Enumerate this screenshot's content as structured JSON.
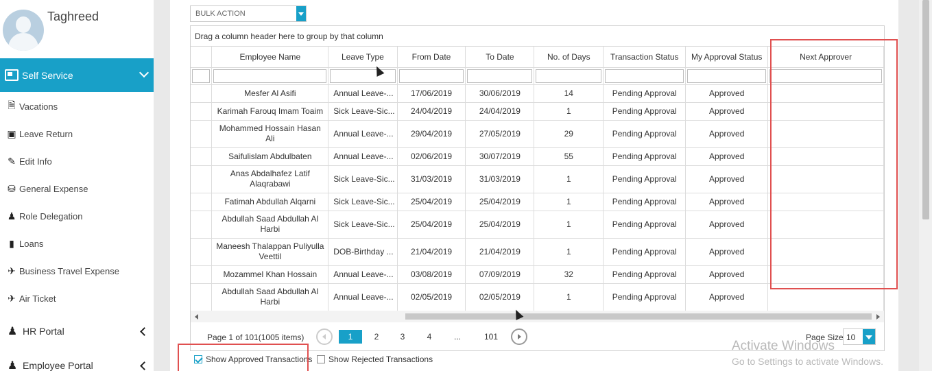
{
  "user": {
    "name": "Taghreed"
  },
  "sidebar": {
    "active": {
      "label": "Self Service",
      "icon": "self-service-icon"
    },
    "sub_items": [
      {
        "label": "Vacations",
        "icon": "document-icon"
      },
      {
        "label": "Leave Return",
        "icon": "leave-return-icon"
      },
      {
        "label": "Edit Info",
        "icon": "edit-info-icon"
      },
      {
        "label": "General Expense",
        "icon": "coins-icon"
      },
      {
        "label": "Role Delegation",
        "icon": "user-icon"
      },
      {
        "label": "Loans",
        "icon": "file-icon"
      },
      {
        "label": "Business Travel Expense",
        "icon": "plane-icon"
      },
      {
        "label": "Air Ticket",
        "icon": "plane-icon"
      }
    ],
    "sections": [
      {
        "label": "HR Portal",
        "icon": "users-icon"
      },
      {
        "label": "Employee Portal",
        "icon": "user-icon"
      }
    ]
  },
  "toolbar": {
    "bulk_action": "BULK ACTION"
  },
  "grid": {
    "group_hint": "Drag a column header here to group by that column",
    "columns": [
      "",
      "Employee Name",
      "Leave Type",
      "From Date",
      "To Date",
      "No. of Days",
      "Transaction Status",
      "My Approval Status",
      "Next Approver"
    ],
    "rows": [
      [
        "Mesfer Al Asifi",
        "Annual Leave-...",
        "17/06/2019",
        "30/06/2019",
        "14",
        "Pending Approval",
        "Approved",
        ""
      ],
      [
        "Karimah Farouq Imam Toaim",
        "Sick Leave-Sic...",
        "24/04/2019",
        "24/04/2019",
        "1",
        "Pending Approval",
        "Approved",
        ""
      ],
      [
        "Mohammed Hossain Hasan Ali",
        "Annual Leave-...",
        "29/04/2019",
        "27/05/2019",
        "29",
        "Pending Approval",
        "Approved",
        ""
      ],
      [
        "Saifulislam Abdulbaten",
        "Annual Leave-...",
        "02/06/2019",
        "30/07/2019",
        "55",
        "Pending Approval",
        "Approved",
        ""
      ],
      [
        "Anas Abdalhafez Latif Alaqrabawi",
        "Sick Leave-Sic...",
        "31/03/2019",
        "31/03/2019",
        "1",
        "Pending Approval",
        "Approved",
        ""
      ],
      [
        "Fatimah Abdullah Alqarni",
        "Sick Leave-Sic...",
        "25/04/2019",
        "25/04/2019",
        "1",
        "Pending Approval",
        "Approved",
        ""
      ],
      [
        "Abdullah Saad Abdullah Al Harbi",
        "Sick Leave-Sic...",
        "25/04/2019",
        "25/04/2019",
        "1",
        "Pending Approval",
        "Approved",
        ""
      ],
      [
        "Maneesh Thalappan Puliyulla Veettil",
        "DOB-Birthday ...",
        "21/04/2019",
        "21/04/2019",
        "1",
        "Pending Approval",
        "Approved",
        ""
      ],
      [
        "Mozammel Khan Hossain",
        "Annual Leave-...",
        "03/08/2019",
        "07/09/2019",
        "32",
        "Pending Approval",
        "Approved",
        ""
      ],
      [
        "Abdullah Saad Abdullah Al Harbi",
        "Annual Leave-...",
        "02/05/2019",
        "02/05/2019",
        "1",
        "Pending Approval",
        "Approved",
        ""
      ]
    ]
  },
  "pager": {
    "info": "Page 1 of 101(1005 items)",
    "pages": [
      "1",
      "2",
      "3",
      "4",
      "...",
      "101"
    ],
    "page_size_label": "Page Size",
    "page_size": "10"
  },
  "filters": {
    "show_approved": "Show Approved Transactions",
    "show_approved_checked": true,
    "show_rejected": "Show Rejected Transactions",
    "show_rejected_checked": false
  },
  "watermark": {
    "line1": "Activate Windows",
    "line2": "Go to Settings to activate Windows."
  },
  "colors": {
    "accent": "#18a0c8",
    "highlight": "#e05050"
  }
}
